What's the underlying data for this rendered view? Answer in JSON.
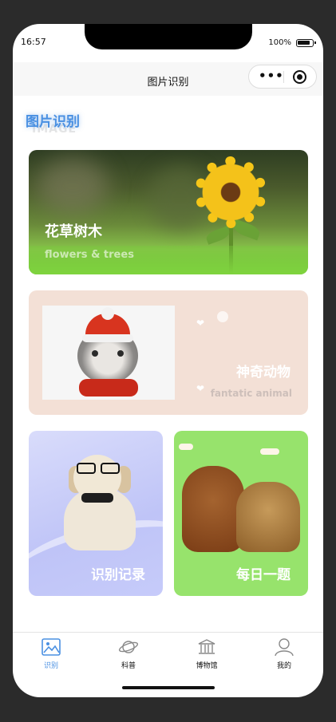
{
  "status": {
    "time": "16:57",
    "battery": "100%"
  },
  "navbar": {
    "title": "图片识别",
    "more_icon": "more-dots-icon",
    "close_icon": "target-icon"
  },
  "section": {
    "title": "图片识别",
    "subtitle": "IMAGE"
  },
  "cards": {
    "plants": {
      "title": "花草树木",
      "subtitle": "flowers & trees"
    },
    "animals": {
      "title": "神奇动物",
      "subtitle": "fantatic animal"
    },
    "records": {
      "title": "识别记录"
    },
    "quiz": {
      "title": "每日一题"
    }
  },
  "tabbar": {
    "items": [
      {
        "label": "识别",
        "icon": "image-icon",
        "active": true
      },
      {
        "label": "科普",
        "icon": "planet-icon",
        "active": false
      },
      {
        "label": "博物馆",
        "icon": "museum-icon",
        "active": false
      },
      {
        "label": "我的",
        "icon": "user-icon",
        "active": false
      }
    ]
  },
  "colors": {
    "accent": "#4a90e2",
    "animals_bg": "#f3e0d6",
    "records_bg": "#c6cbfa",
    "quiz_bg": "#97e36c"
  }
}
